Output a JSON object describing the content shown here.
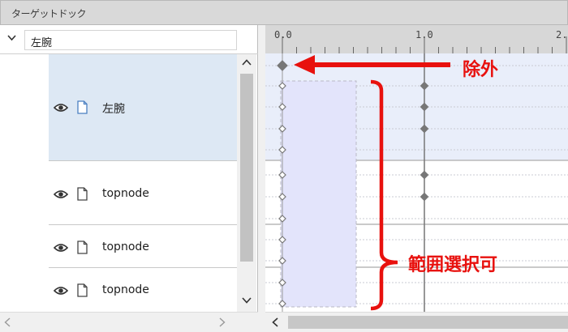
{
  "window": {
    "title": "ターゲットドック"
  },
  "tree": {
    "search_value": "左腕",
    "rows": [
      {
        "label": "左腕",
        "selected": true
      },
      {
        "label": "topnode",
        "selected": false
      },
      {
        "label": "topnode",
        "selected": false
      },
      {
        "label": "topnode",
        "selected": false
      }
    ]
  },
  "timeline": {
    "ruler_labels": [
      "0.0",
      "1.0",
      "2."
    ]
  },
  "annotations": {
    "exclude_label": "除外",
    "range_label": "範囲選択可",
    "color": "#e8110e"
  },
  "colors": {
    "selected_row_bg": "#dde8f4",
    "selection_box_bg": "#e3e4fb",
    "keyframe": "#777777"
  }
}
